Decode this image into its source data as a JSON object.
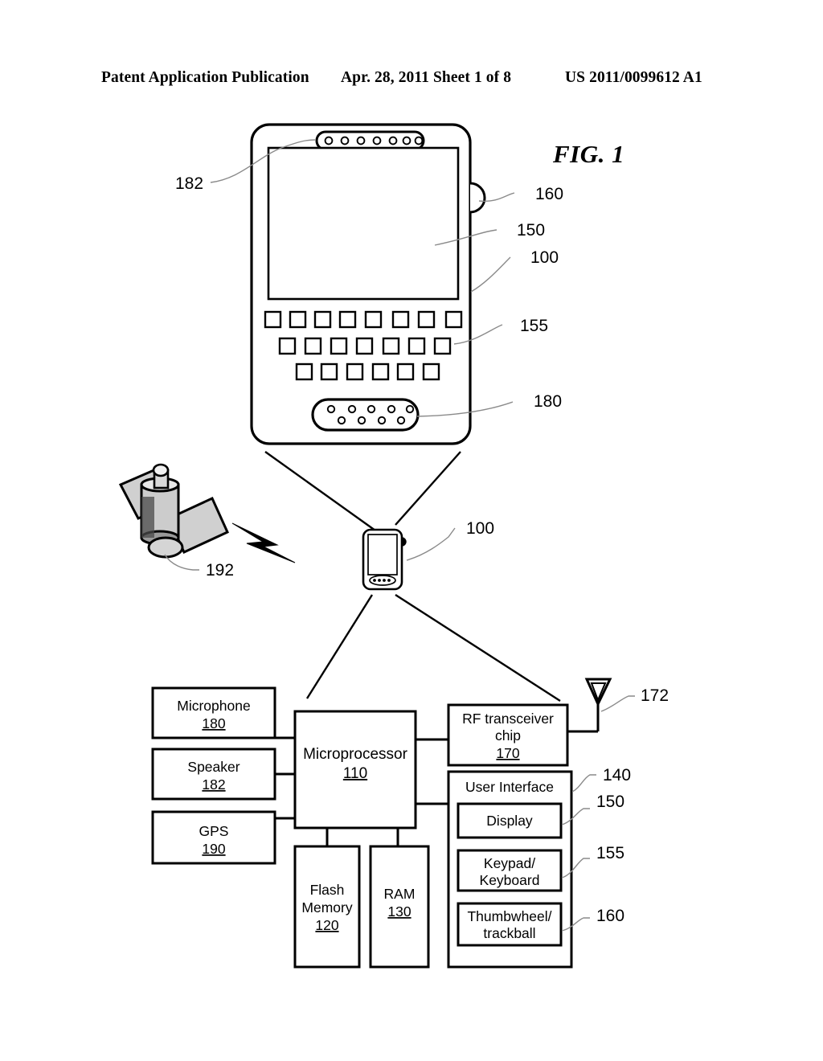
{
  "header": {
    "left": "Patent Application Publication",
    "center": "Apr. 28, 2011  Sheet 1 of 8",
    "right": "US 2011/0099612 A1"
  },
  "figure": {
    "label": "FIG. 1"
  },
  "device_illustration": {
    "callouts": {
      "speaker": "182",
      "thumbwheel": "160",
      "display": "150",
      "device": "100",
      "keyboard": "155",
      "microphone": "180"
    }
  },
  "network_illustration": {
    "callouts": {
      "satellite": "192",
      "device": "100"
    }
  },
  "block_diagram": {
    "blocks": {
      "microphone": {
        "label": "Microphone",
        "num": "180"
      },
      "speaker": {
        "label": "Speaker",
        "num": "182"
      },
      "gps": {
        "label": "GPS",
        "num": "190"
      },
      "microprocessor": {
        "label": "Microprocessor",
        "num": "110"
      },
      "flash_memory": {
        "label_line1": "Flash",
        "label_line2": "Memory",
        "num": "120"
      },
      "ram": {
        "label": "RAM",
        "num": "130"
      },
      "rf_transceiver": {
        "label_line1": "RF transceiver",
        "label_line2": "chip",
        "num": "170"
      },
      "user_interface": {
        "label": "User Interface",
        "num": "140"
      },
      "display": {
        "label": "Display",
        "num": "150"
      },
      "keypad": {
        "label_line1": "Keypad/",
        "label_line2": "Keyboard",
        "num": "155"
      },
      "thumbwheel": {
        "label_line1": "Thumbwheel/",
        "label_line2": "trackball",
        "num": "160"
      }
    },
    "antenna": {
      "num": "172"
    }
  },
  "colors": {
    "line": "#000000",
    "leader": "#777777",
    "background": "#ffffff",
    "satellite_fill": "#c8c8c8"
  }
}
